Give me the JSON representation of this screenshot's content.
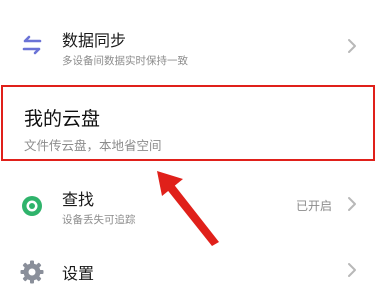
{
  "settings_list": {
    "items": [
      {
        "title": "数据同步",
        "subtitle": "多设备间数据实时保持一致",
        "icon": "sync-arrows-icon"
      },
      {
        "title": "我的云盘",
        "subtitle": "文件传云盘，本地省空间",
        "icon": "none"
      },
      {
        "title": "查找",
        "subtitle": "设备丢失可追踪",
        "status": "已开启",
        "icon": "find-device-icon"
      },
      {
        "title": "设置",
        "icon": "gear-icon"
      }
    ]
  },
  "colors": {
    "highlight_border": "#e0201a",
    "annotation_arrow": "#e0201a",
    "sync_icon": "#6b73d6",
    "find_icon": "#2fb36b"
  }
}
